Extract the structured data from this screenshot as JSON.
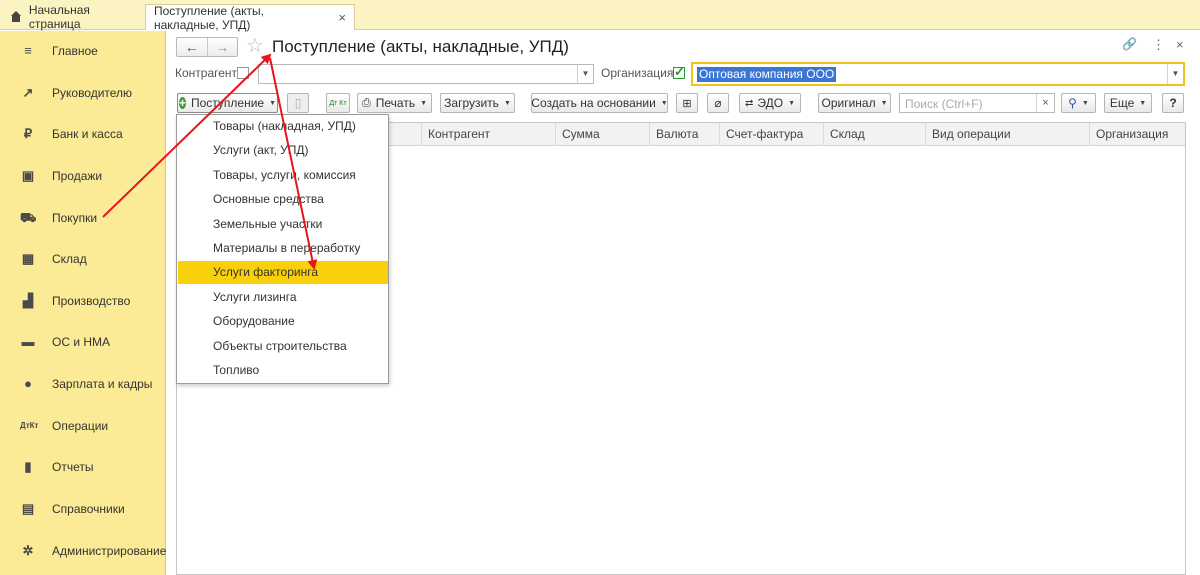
{
  "tabs": {
    "home": "Начальная страница",
    "active": "Поступление (акты, накладные, УПД)",
    "close": "×"
  },
  "sidebar": {
    "items": [
      {
        "label": "Главное",
        "icon": "menu-lines-icon"
      },
      {
        "label": "Руководителю",
        "icon": "trend-icon"
      },
      {
        "label": "Банк и касса",
        "icon": "ruble-coin-icon"
      },
      {
        "label": "Продажи",
        "icon": "shopping-bag-icon"
      },
      {
        "label": "Покупки",
        "icon": "cart-icon"
      },
      {
        "label": "Склад",
        "icon": "warehouse-grid-icon"
      },
      {
        "label": "Производство",
        "icon": "factory-icon"
      },
      {
        "label": "ОС и НМА",
        "icon": "truck-icon"
      },
      {
        "label": "Зарплата и кадры",
        "icon": "person-icon"
      },
      {
        "label": "Операции",
        "icon": "dt-kt-icon"
      },
      {
        "label": "Отчеты",
        "icon": "bar-chart-icon"
      },
      {
        "label": "Справочники",
        "icon": "books-icon"
      },
      {
        "label": "Администрирование",
        "icon": "gear-icon"
      }
    ]
  },
  "header": {
    "title": "Поступление (акты, накладные, УПД)",
    "back": "←",
    "forward": "→",
    "star": "☆",
    "link": "🔗",
    "more": "⋮",
    "close": "×"
  },
  "filters": {
    "counterparty_label": "Контрагент:",
    "counterparty_value": "",
    "organization_label": "Организация:",
    "organization_value": "Оптовая компания ООО"
  },
  "toolbar": {
    "create": "Поступление",
    "dt_kt": "Дт Кт",
    "print": "Печать",
    "load": "Загрузить",
    "create_based": "Создать на основании",
    "edo": "ЭДО",
    "original": "Оригинал",
    "search_placeholder": "Поиск (Ctrl+F)",
    "search_clear": "×",
    "more": "Еще",
    "help": "?"
  },
  "table": {
    "columns": [
      "Контрагент",
      "Сумма",
      "Валюта",
      "Счет-фактура",
      "Склад",
      "Вид операции",
      "Организация"
    ]
  },
  "menu": {
    "items": [
      "Товары (накладная, УПД)",
      "Услуги (акт, УПД)",
      "Товары, услуги, комиссия",
      "Основные средства",
      "Земельные участки",
      "Материалы в переработку",
      "Услуги факторинга",
      "Услуги лизинга",
      "Оборудование",
      "Объекты строительства",
      "Топливо"
    ],
    "highlighted_index": 6
  },
  "colors": {
    "sidebar_bg": "#fbeb96",
    "highlight": "#f9d10b",
    "annotation_arrow": "#e8141c",
    "selection": "#3b76d6"
  }
}
